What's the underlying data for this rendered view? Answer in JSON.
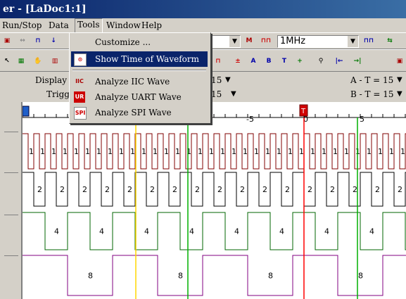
{
  "window": {
    "title": "er - [LaDoc1:1]"
  },
  "menu": {
    "runstop": "Run/Stop",
    "data": "Data",
    "tools": "Tools",
    "window": "Window",
    "help": "Help"
  },
  "tools_menu": {
    "customize": "Customize ...",
    "show_time": "Show Time of Waveform",
    "iic": "Analyze IIC Wave",
    "uart": "Analyze UART Wave",
    "spi": "Analyze SPI Wave"
  },
  "toolbar": {
    "frequency": "1MHz",
    "trigger_marker": "T"
  },
  "info": {
    "display_label": "Display Po",
    "display_value": "-15",
    "trigger_label": "Trigger Po",
    "trigger_value": "15",
    "a_t": "A - T = 15",
    "b_t": "B - T = 15"
  },
  "ruler": {
    "tick_m5": "-5",
    "tick_0": "0",
    "tick_5": "5"
  },
  "channels": [
    {
      "label": "1",
      "color": "#800000"
    },
    {
      "label": "2",
      "color": "#000000"
    },
    {
      "label": "4",
      "color": "#006400"
    },
    {
      "label": "8",
      "color": "#800080"
    }
  ],
  "colors": {
    "cursor_yellow": "#ffd700",
    "cursor_green": "#00b000",
    "cursor_red": "#ff0000",
    "highlight": "#0a246a"
  }
}
